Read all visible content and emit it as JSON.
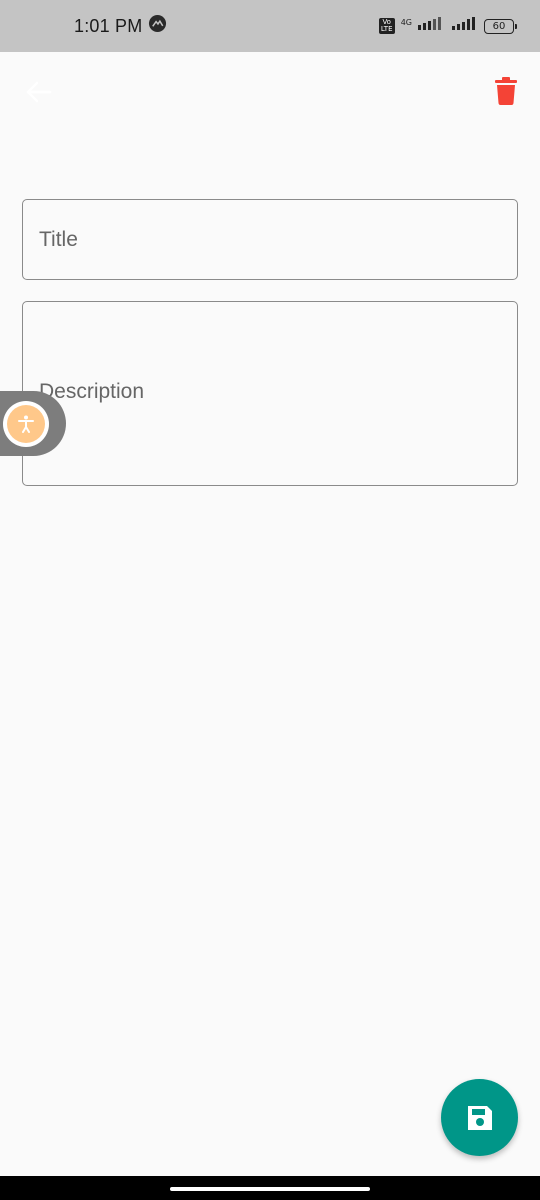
{
  "status_bar": {
    "time": "1:01 PM",
    "volte_label": "Vo\nLTE",
    "network_type": "4G",
    "battery": "60",
    "icons": [
      "alert-icon",
      "signal-icon",
      "signal-icon",
      "battery-icon"
    ]
  },
  "app_bar": {
    "back_icon": "arrow-left-icon",
    "delete_icon": "trash-icon",
    "delete_color": "#f44336",
    "back_color": "#ffffff"
  },
  "form": {
    "title": {
      "value": "",
      "placeholder": "Title"
    },
    "description": {
      "value": "",
      "placeholder": "Description"
    }
  },
  "accessibility_button": {
    "icon": "accessibility-icon",
    "color": "#ffc88a"
  },
  "fab": {
    "icon": "save-icon",
    "color": "#009688"
  }
}
